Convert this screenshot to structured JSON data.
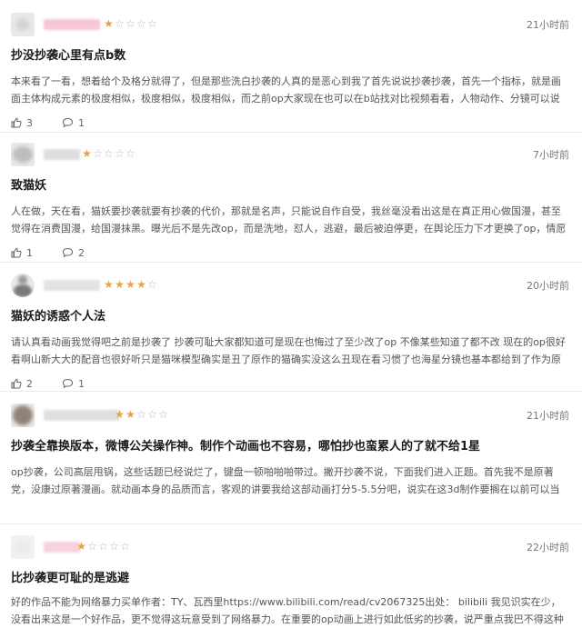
{
  "reviews": [
    {
      "rating": 1,
      "time": "21小时前",
      "title": "抄没抄袭心里有点b数",
      "body": "本来看了一看，想着给个及格分就得了，但是那些洗白抄袭的人真的是恶心到我了首先说说抄袭抄袭，首先一个指标，就是画面主体构成元素的极度相似，极度相似，极度相似，而之前op大家现在也可以在b站找对比视频看看，人物动作、分镜可以说是完全照搬。很多人还说，这是...",
      "likes": "3",
      "comments": "1"
    },
    {
      "rating": 1,
      "time": "7小时前",
      "title": "致猫妖",
      "body": "人在做，天在看，猫妖要抄袭就要有抄袭的代价，那就是名声，只能说自作自受，我丝毫没看出这是在真正用心做国漫，甚至觉得在消费国漫，给国漫抹黑。曝光后不是先改op，而是洗地，怼人，逃避，最后被迫停更，在舆论压力下才更换了op，情愿吗？我看是不情愿的。所以...",
      "likes": "1",
      "comments": "2"
    },
    {
      "rating": 4,
      "time": "20小时前",
      "title": "猫妖的诱惑个人法",
      "body": "请认真看动画我觉得吧之前是抄袭了 抄袭可耻大家都知道可是现在也悔过了至少改了op 不像某些知道了都不改 现在的op很好看啊山新大大的配音也很好听只是猫咪模型确实是丑了原作的猫确实没这么丑现在看习惯了也海星分镜也基本都给到了作为原著党觉得吧 你当时抄袭op是...",
      "likes": "2",
      "comments": "1"
    },
    {
      "rating": 2,
      "time": "21小时前",
      "title": "抄袭全靠换版本，微博公关操作神。制作个动画也不容易，哪怕抄也蛮累人的了就不给1星",
      "body": "op抄袭，公司高层甩锅，这些话题已经说烂了，键盘一顿啪啪啪带过。撇开抄袭不说，下面我们进入正题。首先我不是原著党，没康过原著漫画。就动画本身的品质而言，客观的讲要我给这部动画打分5-5.5分吧，说实在这3d制作要搁在以前可以当得起还算出色这个评价，但是放到...",
      "likes": "",
      "comments": ""
    },
    {
      "rating": 1,
      "time": "22小时前",
      "title": "比抄袭更可耻的是逃避",
      "body": "好的作品不能为网络暴力买单作者：TY、瓦西里https://www.bilibili.com/read/cv2067325出处： bilibili 我见识实在少，没看出来这是一个好作品，更不觉得这玩意受到了网络暴力。在重要的op动画上进行如此低劣的抄袭，说严重点我巴不得这种不要脸的公司赶紧死掉。在被人...",
      "likes": "",
      "comments": ""
    }
  ],
  "colors": {
    "star_on": "#e8a33d",
    "star_off": "#b9b9b9"
  },
  "icons": {
    "like": "thumbs-up-icon",
    "comment": "comment-bubble-icon"
  }
}
